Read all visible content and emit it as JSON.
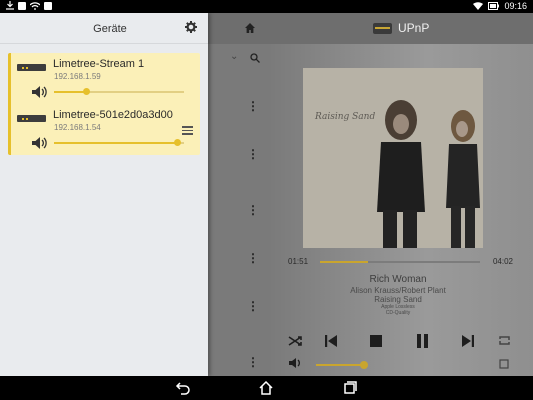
{
  "status_bar": {
    "time": "09:16",
    "left_icons": [
      "download-icon",
      "image-icon",
      "wifi-icon",
      "gallery-icon"
    ],
    "right_icons": [
      "wifi-signal-icon",
      "battery-icon"
    ]
  },
  "drawer": {
    "title": "Geräte",
    "devices": [
      {
        "name": "Limetree-Stream 1",
        "ip": "192.168.1.59",
        "volume": 0.25
      },
      {
        "name": "Limetree-501e2d0a3d00",
        "ip": "192.168.1.54",
        "volume": 0.95
      }
    ]
  },
  "app": {
    "title": "UPnP",
    "accent_color": "#e6c02c"
  },
  "player": {
    "album_cover_text": "Raising Sand",
    "current_time": "01:51",
    "total_time": "04:02",
    "progress": 0.3,
    "track_title": "Rich Woman",
    "artist": "Alison Krauss/Robert Plant",
    "album": "Raising Sand",
    "extra_info_1": "Apple Lossless",
    "extra_info_2": "CD-Quality",
    "volume": 0.3
  },
  "navbar": {
    "icons": [
      "back-icon",
      "home-icon",
      "recents-icon"
    ]
  }
}
